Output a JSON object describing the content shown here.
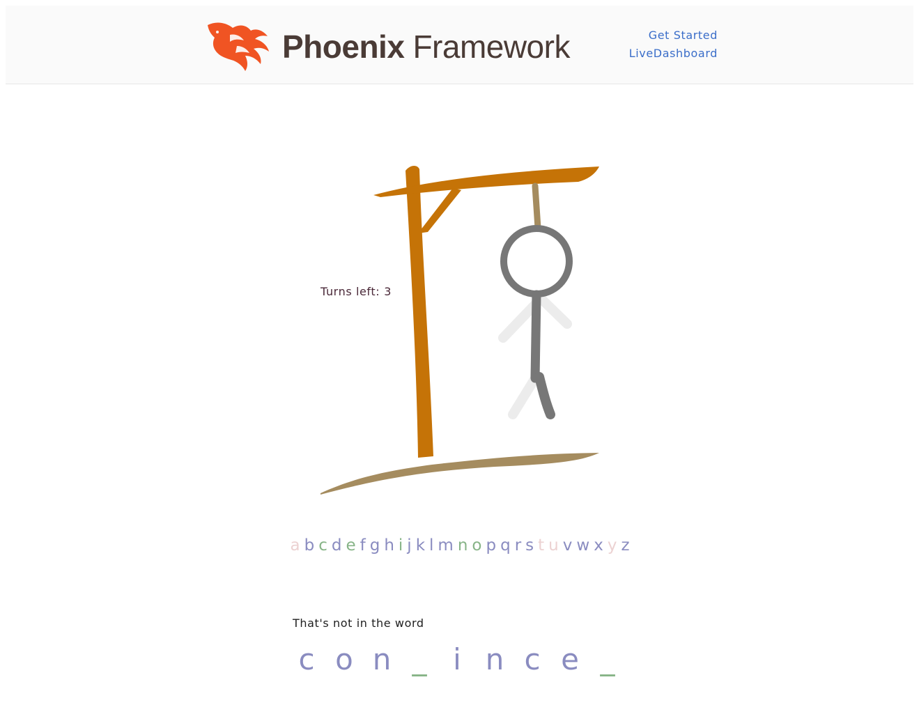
{
  "header": {
    "logo": {
      "name_bold": "Phoenix",
      "name_light": "Framework",
      "brand_color": "#f05423"
    },
    "nav": [
      {
        "label": "Get Started"
      },
      {
        "label": "LiveDashboard"
      }
    ],
    "link_color": "#3b6ec9"
  },
  "game": {
    "turns_label": "Turns left:",
    "turns_left": "3",
    "message": "That's not in the word",
    "word": [
      "c",
      "o",
      "n",
      "_",
      "i",
      "n",
      "c",
      "e",
      "_"
    ],
    "alphabet": [
      {
        "letter": "a",
        "state": "wrong"
      },
      {
        "letter": "b",
        "state": "unused"
      },
      {
        "letter": "c",
        "state": "correct"
      },
      {
        "letter": "d",
        "state": "unused"
      },
      {
        "letter": "e",
        "state": "correct"
      },
      {
        "letter": "f",
        "state": "unused"
      },
      {
        "letter": "g",
        "state": "unused"
      },
      {
        "letter": "h",
        "state": "unused"
      },
      {
        "letter": "i",
        "state": "correct"
      },
      {
        "letter": "j",
        "state": "unused"
      },
      {
        "letter": "k",
        "state": "unused"
      },
      {
        "letter": "l",
        "state": "unused"
      },
      {
        "letter": "m",
        "state": "unused"
      },
      {
        "letter": "n",
        "state": "correct"
      },
      {
        "letter": "o",
        "state": "correct"
      },
      {
        "letter": "p",
        "state": "unused"
      },
      {
        "letter": "q",
        "state": "unused"
      },
      {
        "letter": "r",
        "state": "unused"
      },
      {
        "letter": "s",
        "state": "unused"
      },
      {
        "letter": "t",
        "state": "wrong"
      },
      {
        "letter": "u",
        "state": "wrong"
      },
      {
        "letter": "v",
        "state": "unused"
      },
      {
        "letter": "w",
        "state": "unused"
      },
      {
        "letter": "x",
        "state": "unused"
      },
      {
        "letter": "y",
        "state": "wrong"
      },
      {
        "letter": "z",
        "state": "unused"
      }
    ],
    "colors": {
      "unused": "#8a8cc0",
      "correct": "#87b487",
      "wrong": "#ecd2d2",
      "gallows": "#c57307",
      "ground": "#a58c5f",
      "figure": "#777777",
      "figure_hidden": "#ececec"
    }
  }
}
